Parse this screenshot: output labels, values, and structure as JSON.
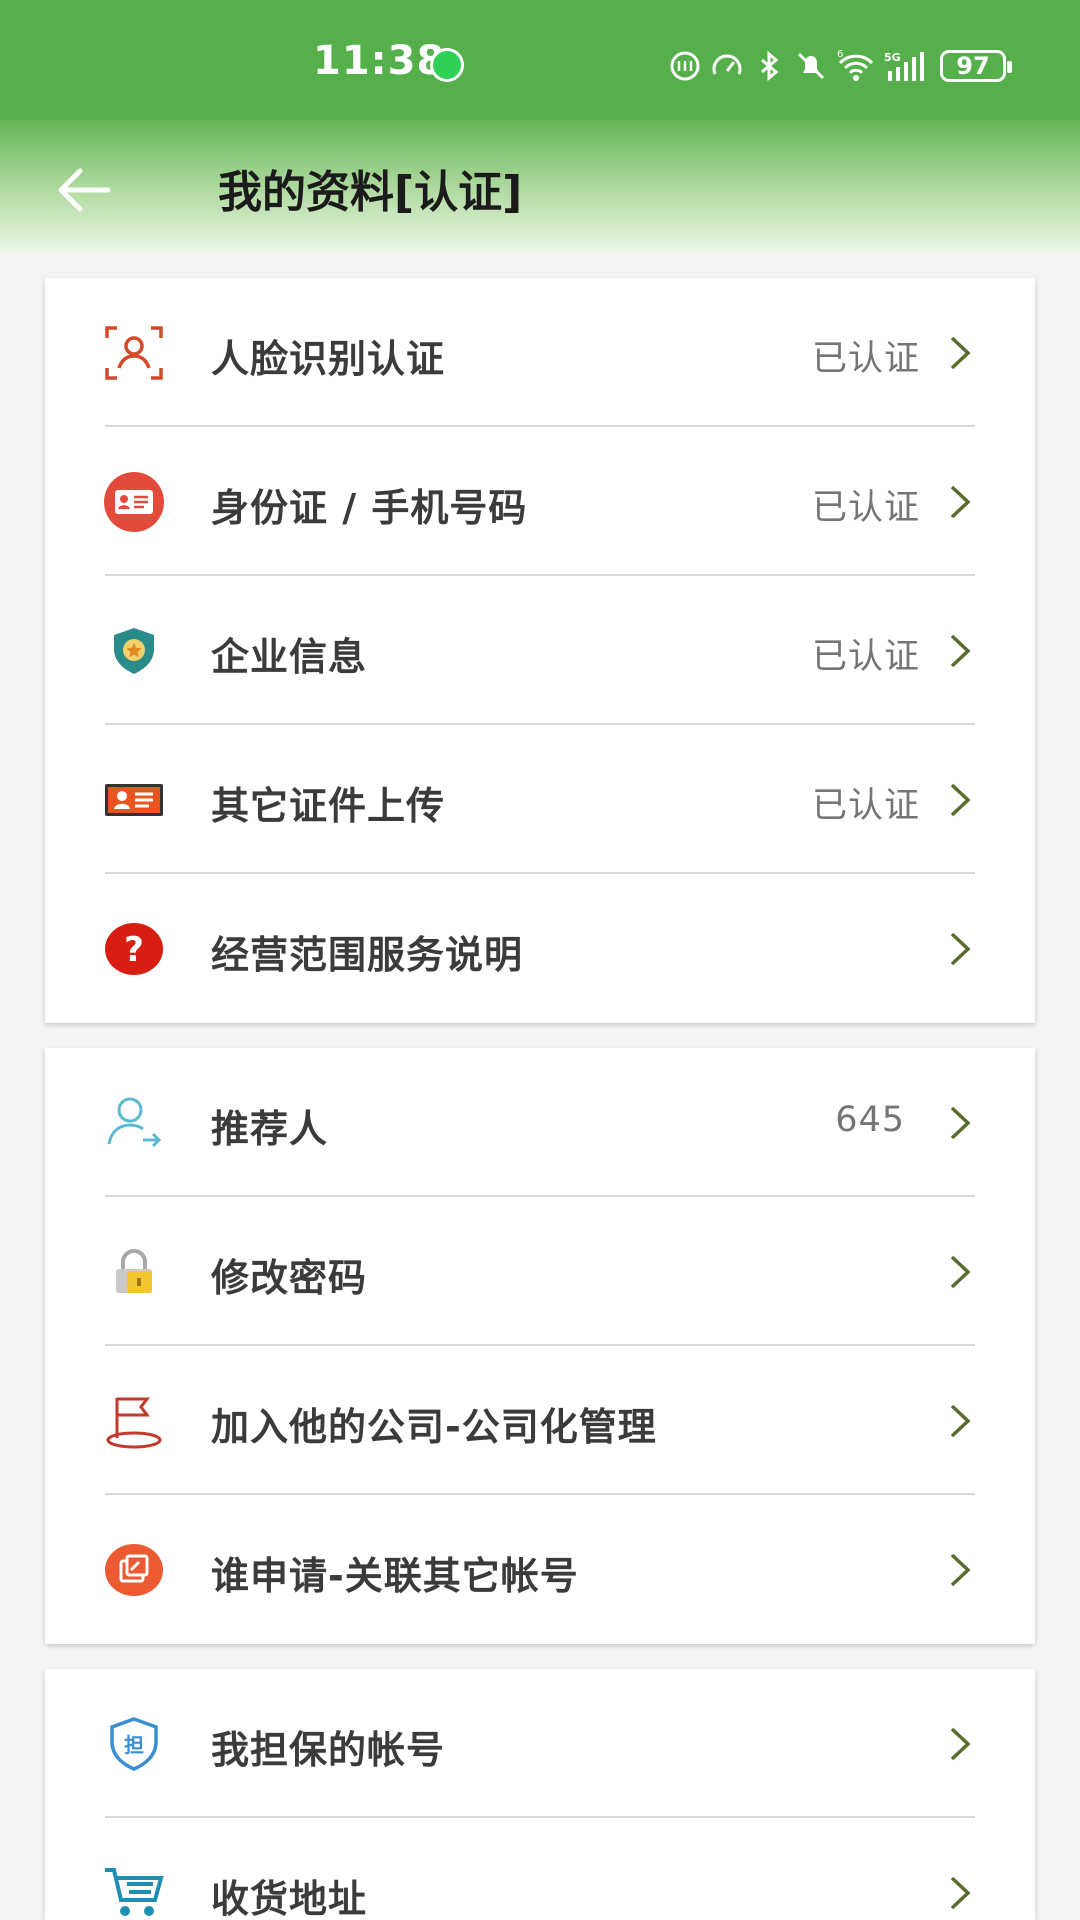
{
  "status_bar": {
    "time": "11:38",
    "battery": "97",
    "network": "5G",
    "wifi_badge": "6"
  },
  "header": {
    "title": "我的资料[认证]"
  },
  "cards": [
    {
      "items": [
        {
          "label": "人脸识别认证",
          "value": "已认证",
          "icon": "face-scan-icon"
        },
        {
          "label": "身份证 / 手机号码",
          "value": "已认证",
          "icon": "id-card-icon"
        },
        {
          "label": "企业信息",
          "value": "已认证",
          "icon": "shield-star-icon"
        },
        {
          "label": "其它证件上传",
          "value": "已认证",
          "icon": "certificate-icon"
        },
        {
          "label": "经营范围服务说明",
          "value": "",
          "icon": "question-icon"
        }
      ]
    },
    {
      "items": [
        {
          "label": "推荐人",
          "value": "645",
          "icon": "referrer-icon"
        },
        {
          "label": "修改密码",
          "value": "",
          "icon": "lock-icon"
        },
        {
          "label": "加入他的公司-公司化管理",
          "value": "",
          "icon": "flag-icon"
        },
        {
          "label": "谁申请-关联其它帐号",
          "value": "",
          "icon": "link-account-icon"
        }
      ]
    },
    {
      "items": [
        {
          "label": "我担保的帐号",
          "value": "",
          "icon": "guarantee-shield-icon",
          "icon_text": "担"
        },
        {
          "label": "收货地址",
          "value": "",
          "icon": "cart-icon"
        }
      ]
    }
  ],
  "colors": {
    "status_bar": "#55b04b",
    "chevron": "#5a6b2f",
    "label": "#3b3b3b",
    "value": "#757575"
  }
}
